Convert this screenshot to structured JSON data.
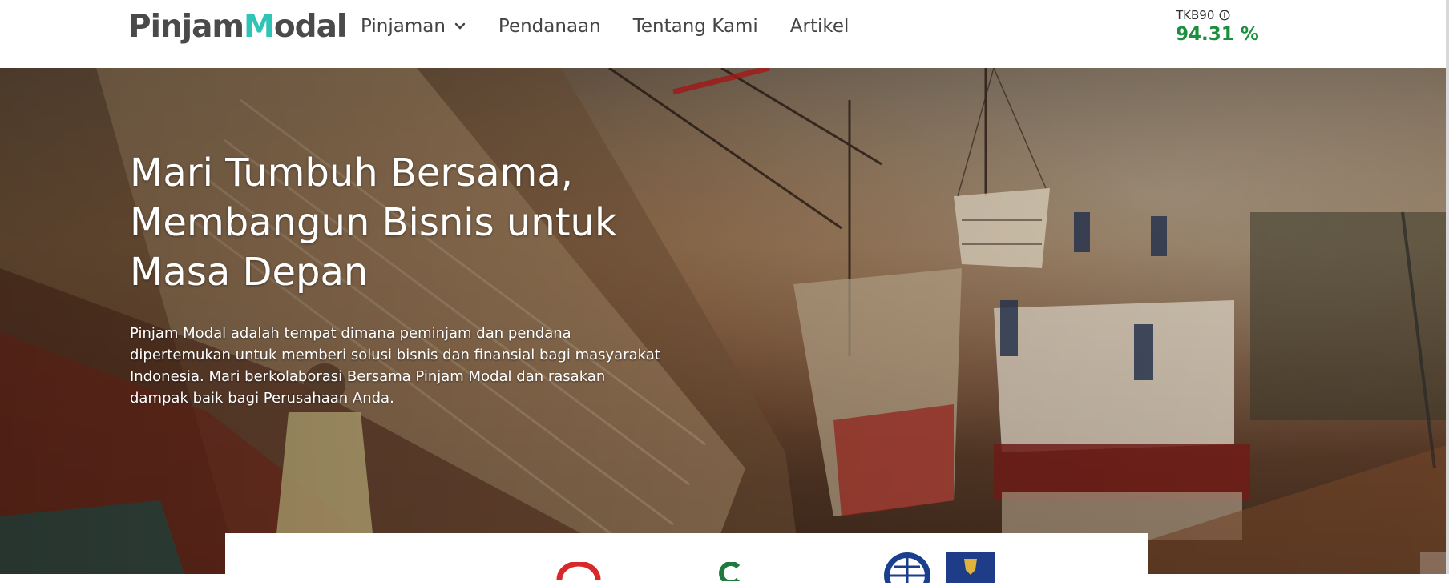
{
  "brand": {
    "logo_left": "Pinjam",
    "logo_accent": "M",
    "logo_right": "odal"
  },
  "nav": {
    "items": [
      {
        "label": "Pinjaman",
        "has_dropdown": true
      },
      {
        "label": "Pendanaan"
      },
      {
        "label": "Tentang Kami"
      },
      {
        "label": "Artikel"
      }
    ]
  },
  "tkb": {
    "label": "TKB90",
    "value": "94.31 %",
    "value_color": "#1b8f3e"
  },
  "hero": {
    "title": "Mari Tumbuh Bersama, Membangun Bisnis untuk Masa Depan",
    "description": "Pinjam Modal adalah tempat dimana peminjam dan pendana dipertemukan untuk memberi solusi bisnis dan finansial bagi masyarakat Indonesia. Mari berkolaborasi Bersama Pinjam Modal dan rasakan dampak baik bagi Perusahaan Anda."
  },
  "partners": {
    "logos": [
      "red-arc-logo",
      "green-logo",
      "iso-27001-logo",
      "crest-logo"
    ]
  },
  "colors": {
    "accent": "#2ec4b6",
    "text": "#444444"
  }
}
